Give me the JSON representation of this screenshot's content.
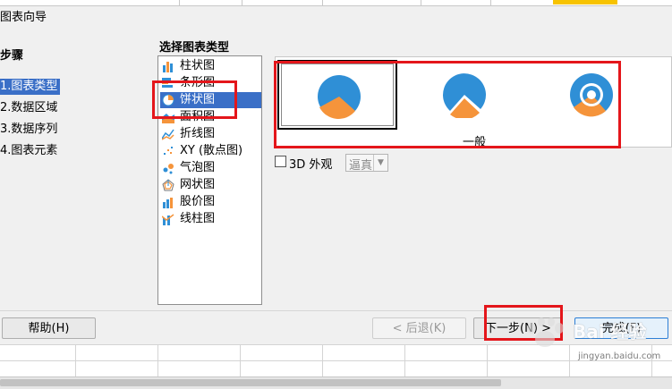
{
  "window": {
    "title": "图表向导"
  },
  "steps": {
    "heading": "步骤",
    "items": [
      "1.图表类型",
      "2.数据区域",
      "3.数据序列",
      "4.图表元素"
    ],
    "selected_index": 0
  },
  "main": {
    "heading": "选择图表类型",
    "chart_types": [
      {
        "label": "柱状图",
        "icon": "column-chart-icon"
      },
      {
        "label": "条形图",
        "icon": "bar-chart-icon"
      },
      {
        "label": "饼状图",
        "icon": "pie-chart-icon"
      },
      {
        "label": "面积图",
        "icon": "area-chart-icon"
      },
      {
        "label": "折线图",
        "icon": "line-chart-icon"
      },
      {
        "label": "XY (散点图)",
        "icon": "scatter-chart-icon"
      },
      {
        "label": "气泡图",
        "icon": "bubble-chart-icon"
      },
      {
        "label": "网状图",
        "icon": "net-chart-icon"
      },
      {
        "label": "股价图",
        "icon": "stock-chart-icon"
      },
      {
        "label": "线柱图",
        "icon": "column-line-chart-icon"
      }
    ],
    "selected_type_index": 2,
    "preview_category": "一般",
    "preview_variants": [
      "pie",
      "exploded-pie",
      "donut",
      "exploded-donut"
    ],
    "selected_variant_index": 0,
    "three_d_label": "3D 外观",
    "three_d_checked": false,
    "look_value": "逼真"
  },
  "buttons": {
    "help": "帮助(H)",
    "back": "< 后退(K)",
    "next": "下一步(N) >",
    "finish": "完成(F)"
  },
  "colors": {
    "pie_blue": "#2f8fd6",
    "pie_orange": "#f5943b",
    "selection": "#3a6fc7",
    "annotation_red": "#e4161b"
  },
  "watermark": {
    "brand": "Bai 经验",
    "url": "jingyan.baidu.com"
  }
}
